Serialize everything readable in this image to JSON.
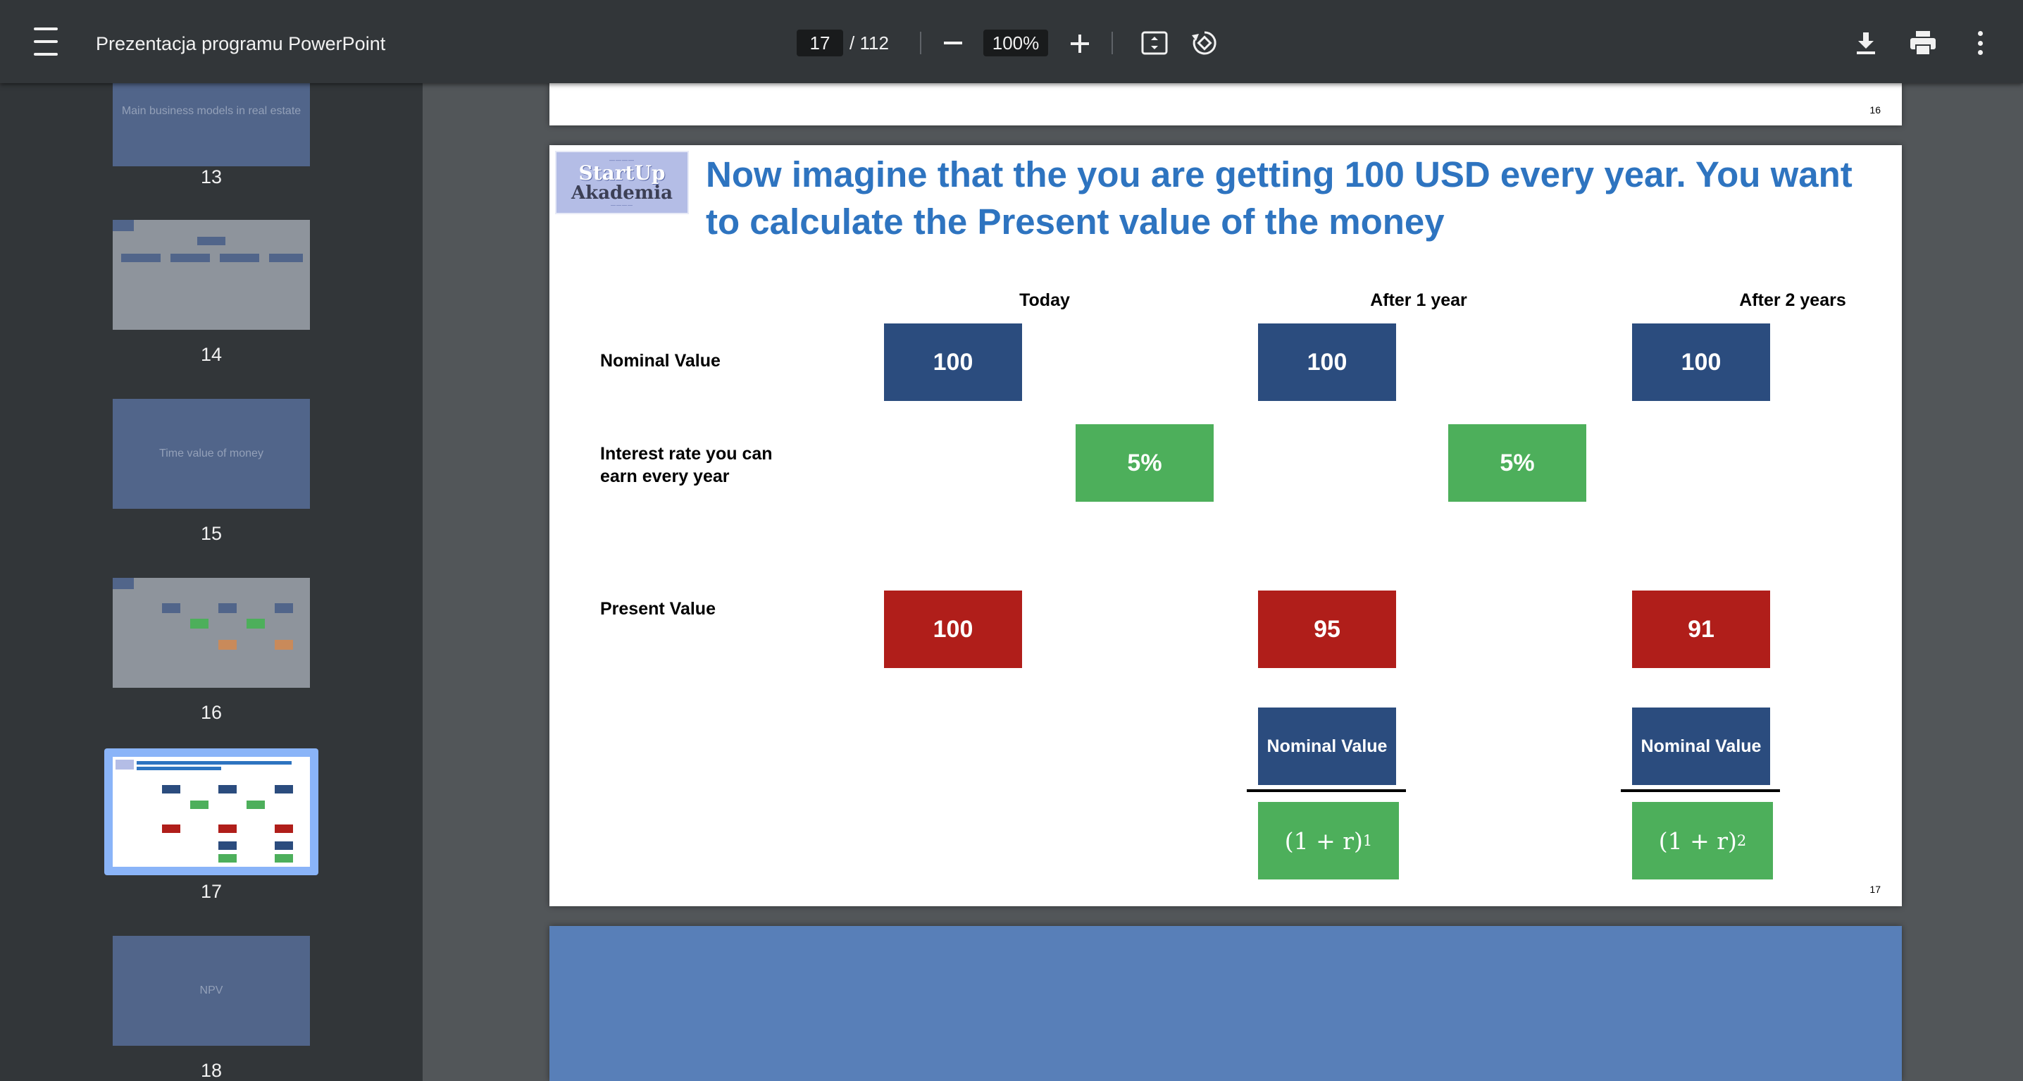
{
  "toolbar": {
    "title": "Prezentacja programu PowerPoint",
    "current_page": "17",
    "total_pages": "/ 112",
    "zoom": "100%"
  },
  "sidebar": {
    "thumbnails": [
      {
        "num": "13",
        "text": "Main business models in real estate"
      },
      {
        "num": "14",
        "text": ""
      },
      {
        "num": "15",
        "text": "Time value of money"
      },
      {
        "num": "16",
        "text": ""
      },
      {
        "num": "17",
        "text": ""
      },
      {
        "num": "18",
        "text": "NPV"
      }
    ]
  },
  "page16": {
    "num": "16"
  },
  "slide": {
    "num": "17",
    "title": "Now imagine that the you are getting 100 USD every year. You want to calculate the Present value of the money",
    "columns": [
      "Today",
      "After 1 year",
      "After 2 years"
    ],
    "rows": {
      "nominal": "Nominal Value",
      "interest": "Interest rate you can earn every year",
      "present": "Present Value"
    },
    "nominal_values": [
      "100",
      "100",
      "100"
    ],
    "interest_values": [
      "5%",
      "5%"
    ],
    "present_values": [
      "100",
      "95",
      "91"
    ],
    "fractions": [
      {
        "numerator": "Nominal Value",
        "denominator": "(1 + r)",
        "exponent": "1"
      },
      {
        "numerator": "Nominal Value",
        "denominator": "(1 + r)",
        "exponent": "2"
      }
    ]
  }
}
